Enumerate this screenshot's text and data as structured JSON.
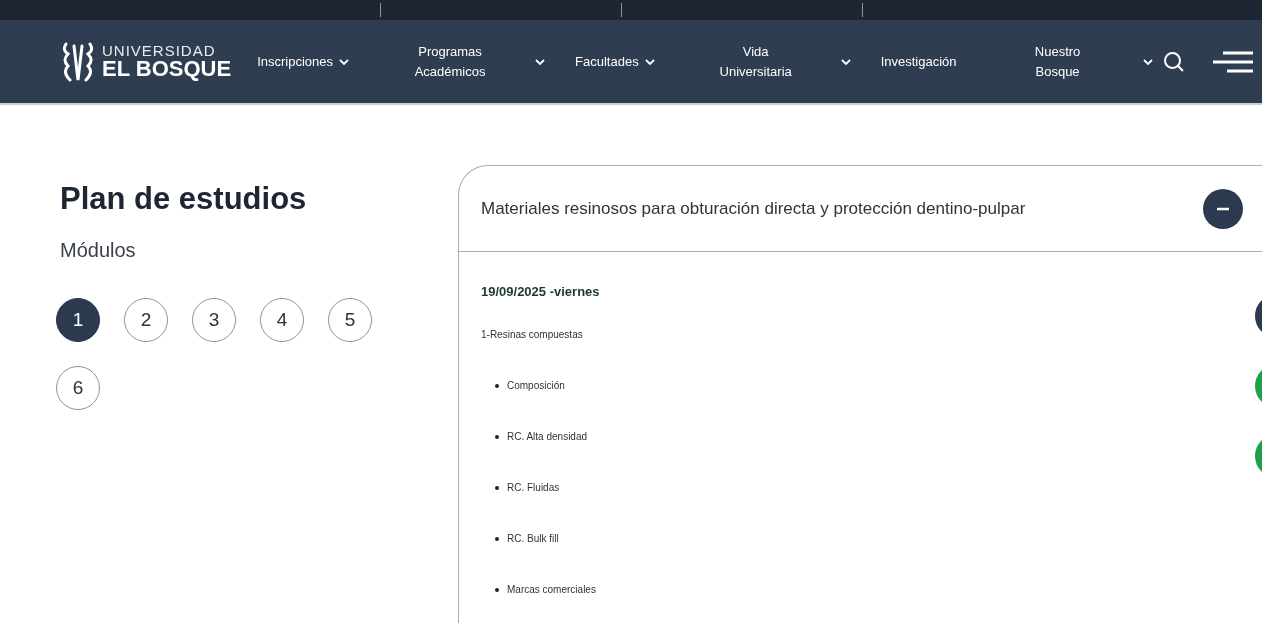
{
  "header": {
    "logo": {
      "line1": "UNIVERSIDAD",
      "line2": "EL BOSQUE"
    },
    "nav": [
      {
        "label": "Inscripciones",
        "dropdown": true
      },
      {
        "label": "Programas Académicos",
        "dropdown": true
      },
      {
        "label": "Facultades",
        "dropdown": true
      },
      {
        "label": "Vida Universitaria",
        "dropdown": true
      },
      {
        "label": "Investigación",
        "dropdown": false
      },
      {
        "label": "Nuestro Bosque",
        "dropdown": true
      }
    ]
  },
  "sidebar": {
    "title": "Plan de estudios",
    "subtitle": "Módulos",
    "modules": [
      {
        "label": "1",
        "selected": true
      },
      {
        "label": "2",
        "selected": false
      },
      {
        "label": "3",
        "selected": false
      },
      {
        "label": "4",
        "selected": false
      },
      {
        "label": "5",
        "selected": false
      },
      {
        "label": "6",
        "selected": false
      }
    ]
  },
  "accordion": {
    "title": "Materiales resinosos para obturación directa y protección dentino-pulpar",
    "expanded": true,
    "date": "19/09/2025 -viernes",
    "topic": "1-Resinas compuestas",
    "items": [
      "Composición",
      "RC. Alta densidad",
      "RC. Fluidas",
      "RC. Bulk fill",
      "Marcas comerciales"
    ]
  },
  "side_buttons": [
    {
      "color": "#2b3a4e"
    },
    {
      "color": "#1fa14a"
    },
    {
      "color": "#1fa14a"
    }
  ]
}
